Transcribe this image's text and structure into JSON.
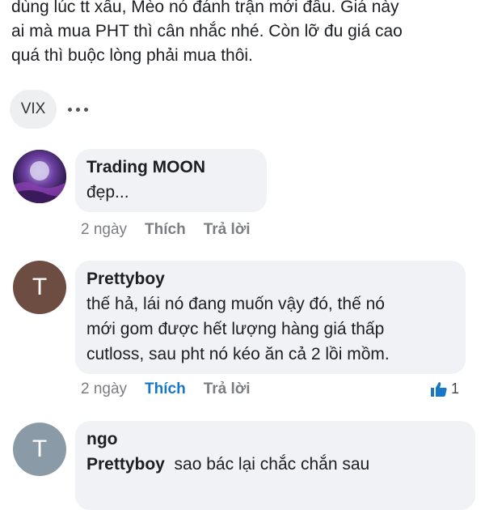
{
  "post": {
    "lines": [
      "dùng lúc tt xấu, Mèo nó đánh trận mới đầu. Giá này",
      "ai mà mua PHT thì cân nhắc nhé. Còn lỡ đu giá cao",
      "quá thì buộc lòng phải mua thôi."
    ],
    "tag": "VIX"
  },
  "comments": [
    {
      "author": "Trading MOON",
      "lines": [
        "đẹp..."
      ],
      "time": "2 ngày",
      "like": "Thích",
      "reply": "Trả lời"
    },
    {
      "avatar_letter": "T",
      "author": "Prettyboy",
      "lines": [
        "thế hả, lái nó đang muốn vậy đó, thế nó",
        "mới gom được hết lượng hàng giá thấp",
        "cutloss, sau pht nó kéo ăn cả 2 lồi mồm."
      ],
      "time": "2 ngày",
      "like": "Thích",
      "reply": "Trả lời",
      "reaction_count": "1"
    },
    {
      "avatar_letter": "T",
      "author": "ngo",
      "mention": "Prettyboy",
      "text": "sao bác lại chắc chắn sau"
    }
  ],
  "colors": {
    "bubble": "#f0f2f5",
    "liked": "#1877c9",
    "avatar_brown": "#6d4c41",
    "avatar_grey": "#8a9aa6"
  }
}
